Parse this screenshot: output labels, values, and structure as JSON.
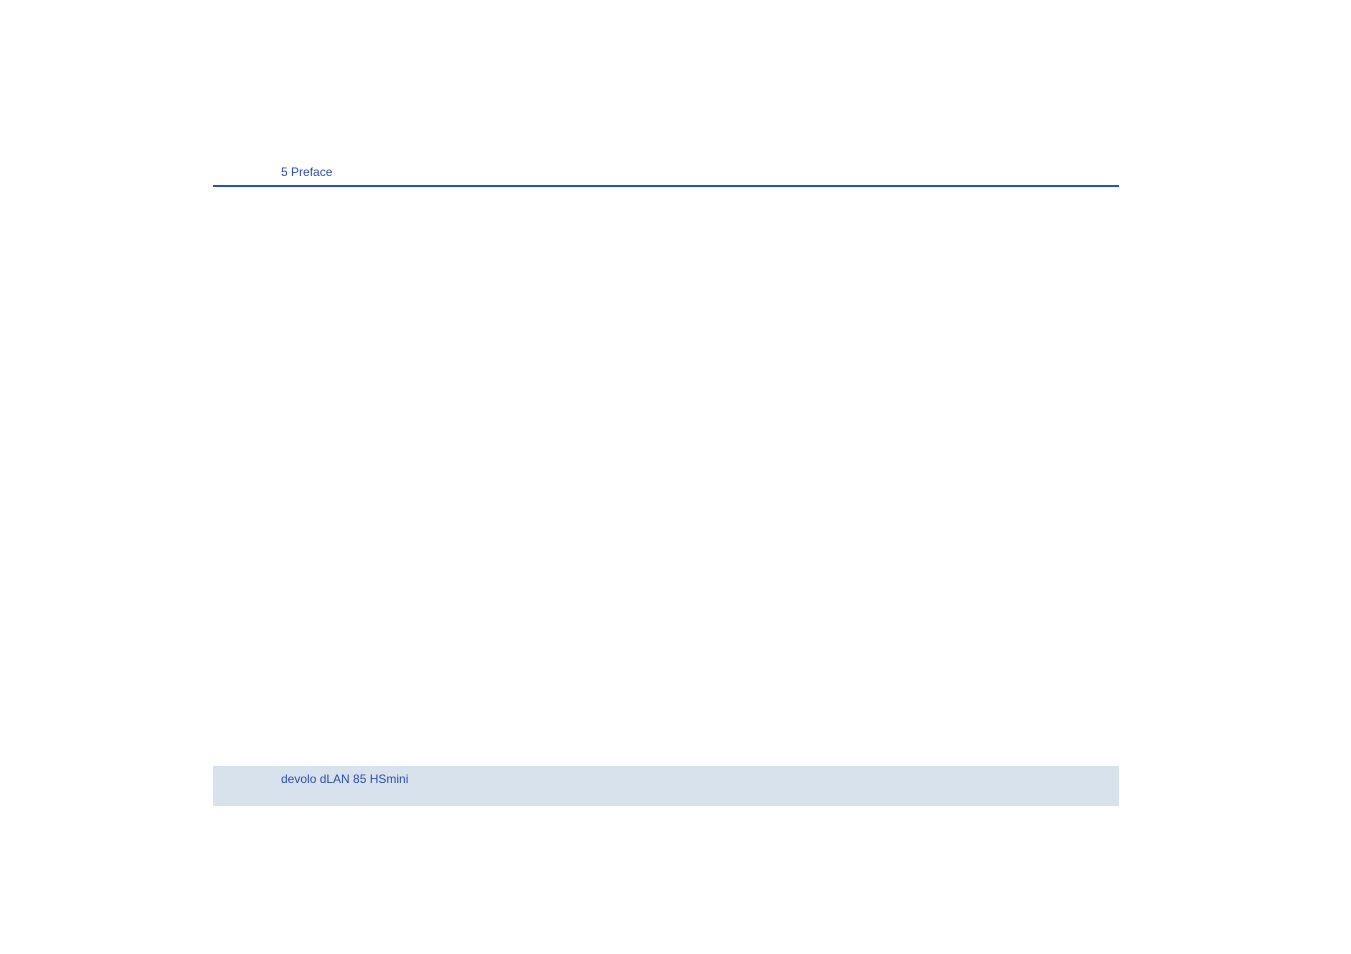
{
  "header": {
    "page_number": "5",
    "section_title": "Preface"
  },
  "footer": {
    "product_name": "devolo dLAN 85 HSmini"
  }
}
